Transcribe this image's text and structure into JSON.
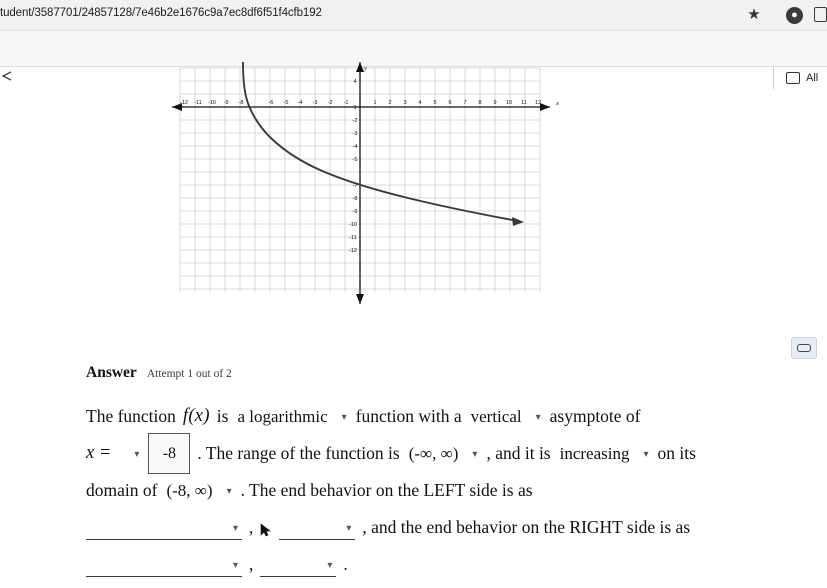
{
  "browser": {
    "url": "tudent/3587701/24857128/7e46b2e1676c9a7ec8df6f51f4cfb192",
    "star_icon": "star-icon",
    "profile_icon": "profile-avatar-icon",
    "menu_icon": "browser-menu-icon",
    "back_icon": "back-arrow-icon",
    "bookmark_icon": "bookmark-folder-icon",
    "bookmark_label": "All"
  },
  "answer": {
    "title": "Answer",
    "attempt": "Attempt 1 out of 2",
    "comment_icon": "comment-icon"
  },
  "problem": {
    "t1": "The function",
    "fx": "f(x)",
    "t2": "is",
    "type_value": "a logarithmic",
    "t3": "function with a",
    "asymptote_value": "vertical",
    "t4": "asymptote of",
    "x_label": "x =",
    "x_op_value": "",
    "x_value": "-8",
    "t5": ". The range of the function is",
    "range_value": "(-∞, ∞)",
    "t6": ", and it is",
    "behavior_value": "increasing",
    "t7": "on its",
    "t8": "domain of",
    "domain_value": "(-8, ∞)",
    "t9": ". The end behavior on the LEFT side is as",
    "blank1": "",
    "comma1": ",",
    "blank2": "",
    "t10": ", and the end behavior on the RIGHT side is as",
    "blank3": "",
    "comma2": ",",
    "blank4": "",
    "period": "."
  },
  "chart_data": {
    "type": "line",
    "title": "",
    "xlabel": "x",
    "ylabel": "y",
    "xlim": [
      -13,
      13
    ],
    "ylim": [
      -12,
      5
    ],
    "grid": true,
    "x_ticks": [
      -12,
      -11,
      -10,
      -9,
      -8,
      -6,
      -5,
      -4,
      -3,
      -2,
      -1,
      1,
      2,
      3,
      4,
      5,
      6,
      7,
      8,
      9,
      10,
      11,
      12
    ],
    "y_ticks": [
      4,
      1,
      -2,
      -3,
      -4,
      -5,
      -7,
      -8,
      -9,
      -10,
      -11,
      -12
    ],
    "series": [
      {
        "name": "f(x)",
        "curve": "logarithmic with vertical asymptote at x = -8, decreasing",
        "points": [
          [
            -7.97,
            4.6
          ],
          [
            -7.9,
            2.2
          ],
          [
            -7.8,
            1.0
          ],
          [
            -7.6,
            0.0
          ],
          [
            -7.2,
            -1.2
          ],
          [
            -6.6,
            -2.2
          ],
          [
            -6.0,
            -2.9
          ],
          [
            -5.0,
            -3.8
          ],
          [
            -4.0,
            -4.4
          ],
          [
            -3.0,
            -4.9
          ],
          [
            -2.0,
            -5.4
          ],
          [
            -1.0,
            -5.8
          ],
          [
            0.0,
            -6.1
          ],
          [
            1.0,
            -6.4
          ],
          [
            2.0,
            -6.7
          ],
          [
            3.0,
            -6.95
          ],
          [
            4.0,
            -7.2
          ],
          [
            5.0,
            -7.4
          ],
          [
            6.0,
            -7.6
          ],
          [
            7.0,
            -7.8
          ],
          [
            8.0,
            -7.95
          ],
          [
            9.0,
            -8.1
          ],
          [
            10.0,
            -8.3
          ],
          [
            11.0,
            -8.45
          ],
          [
            11.8,
            -8.55
          ]
        ]
      }
    ]
  }
}
